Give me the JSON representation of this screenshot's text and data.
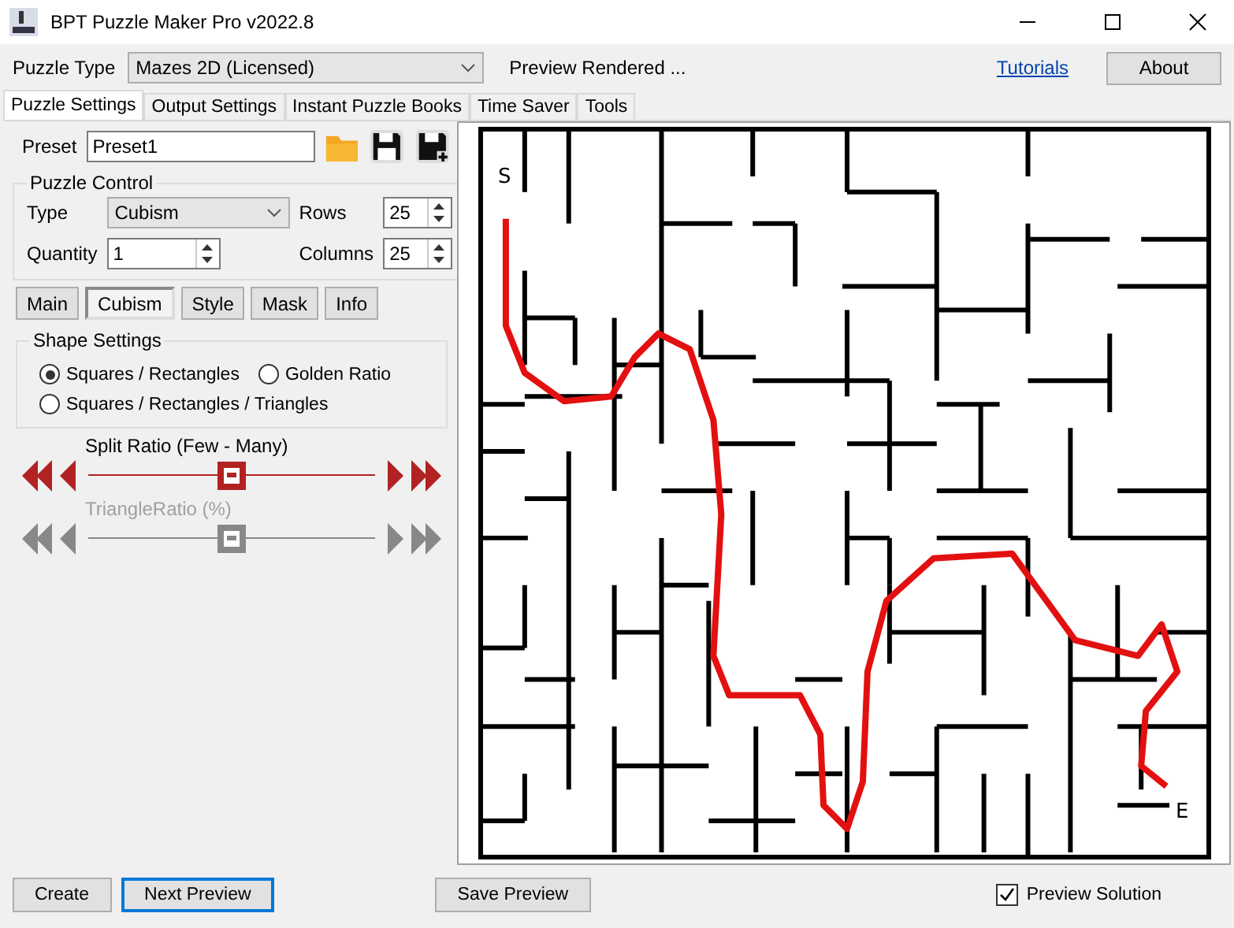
{
  "window": {
    "title": "BPT Puzzle Maker Pro v2022.8"
  },
  "toolbar": {
    "puzzle_type_label": "Puzzle Type",
    "puzzle_type": "Mazes 2D (Licensed)",
    "status": "Preview Rendered ...",
    "tutorials_link": "Tutorials",
    "about_button": "About"
  },
  "tabs": [
    {
      "label": "Puzzle Settings",
      "selected": true
    },
    {
      "label": "Output Settings",
      "selected": false
    },
    {
      "label": "Instant Puzzle Books",
      "selected": false
    },
    {
      "label": "Time Saver",
      "selected": false
    },
    {
      "label": "Tools",
      "selected": false
    }
  ],
  "preset": {
    "label": "Preset",
    "value": "Preset1"
  },
  "puzzle_control": {
    "title": "Puzzle Control",
    "type_label": "Type",
    "type_value": "Cubism",
    "rows_label": "Rows",
    "rows": "25",
    "quantity_label": "Quantity",
    "quantity": "1",
    "columns_label": "Columns",
    "columns": "25"
  },
  "sub_tabs": [
    {
      "label": "Main",
      "selected": false
    },
    {
      "label": "Cubism",
      "selected": true
    },
    {
      "label": "Style",
      "selected": false
    },
    {
      "label": "Mask",
      "selected": false
    },
    {
      "label": "Info",
      "selected": false
    }
  ],
  "shape_settings": {
    "title": "Shape Settings",
    "options": [
      {
        "label": "Squares / Rectangles",
        "selected": true
      },
      {
        "label": "Golden Ratio",
        "selected": false
      },
      {
        "label": "Squares / Rectangles / Triangles",
        "selected": false
      }
    ]
  },
  "sliders": [
    {
      "label": "Split Ratio (Few - Many)",
      "level": 0.5,
      "disabled": false
    },
    {
      "label": "TriangleRatio (%)",
      "level": 0.5,
      "disabled": true
    }
  ],
  "preview": {
    "start_label": "S",
    "end_label": "E"
  },
  "footer": {
    "buttons": [
      {
        "label": "Create",
        "focused": false
      },
      {
        "label": "Next Preview",
        "focused": true
      },
      {
        "label": "Save Preview",
        "focused": false
      }
    ],
    "preview_solution": {
      "label": "Preview Solution",
      "checked": true
    }
  }
}
